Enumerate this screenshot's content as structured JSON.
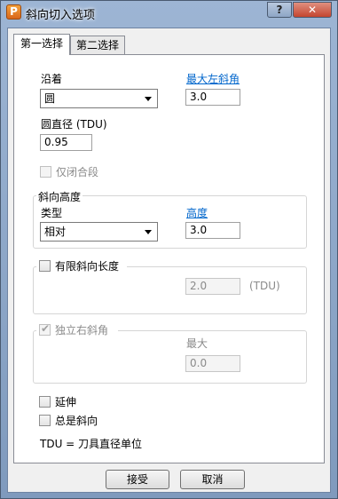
{
  "window": {
    "title": "斜向切入选项",
    "app_icon_letter": "P",
    "help_label": "?",
    "close_label": "✕"
  },
  "tabs": [
    {
      "label": "第一选择",
      "active": true
    },
    {
      "label": "第二选择",
      "active": false
    }
  ],
  "along": {
    "label": "沿着",
    "value": "圆",
    "max_left_angle_label": "最大左斜角",
    "max_left_angle_value": "3.0",
    "diameter_label": "圆直径 (TDU)",
    "diameter_value": "0.95",
    "closed_only_label": "仅闭合段",
    "closed_only_checked": false
  },
  "ramp_height": {
    "group_label": "斜向高度",
    "type_label": "类型",
    "type_value": "相对",
    "height_label": "高度",
    "height_value": "3.0"
  },
  "limit_length": {
    "label": "有限斜向长度",
    "checked": false,
    "value": "2.0",
    "unit": "(TDU)"
  },
  "independent_right": {
    "label": "独立右斜角",
    "checked": true,
    "max_label": "最大",
    "max_value": "0.0"
  },
  "options": {
    "extend_label": "延伸",
    "extend_checked": false,
    "always_ramp_label": "总是斜向",
    "always_ramp_checked": false,
    "tdu_note": "TDU = 刀具直径单位"
  },
  "buttons": {
    "accept": "接受",
    "cancel": "取消"
  },
  "colors": {
    "link": "#0066cc",
    "close_button": "#c4452f",
    "title_bar": "#9db5d4"
  }
}
